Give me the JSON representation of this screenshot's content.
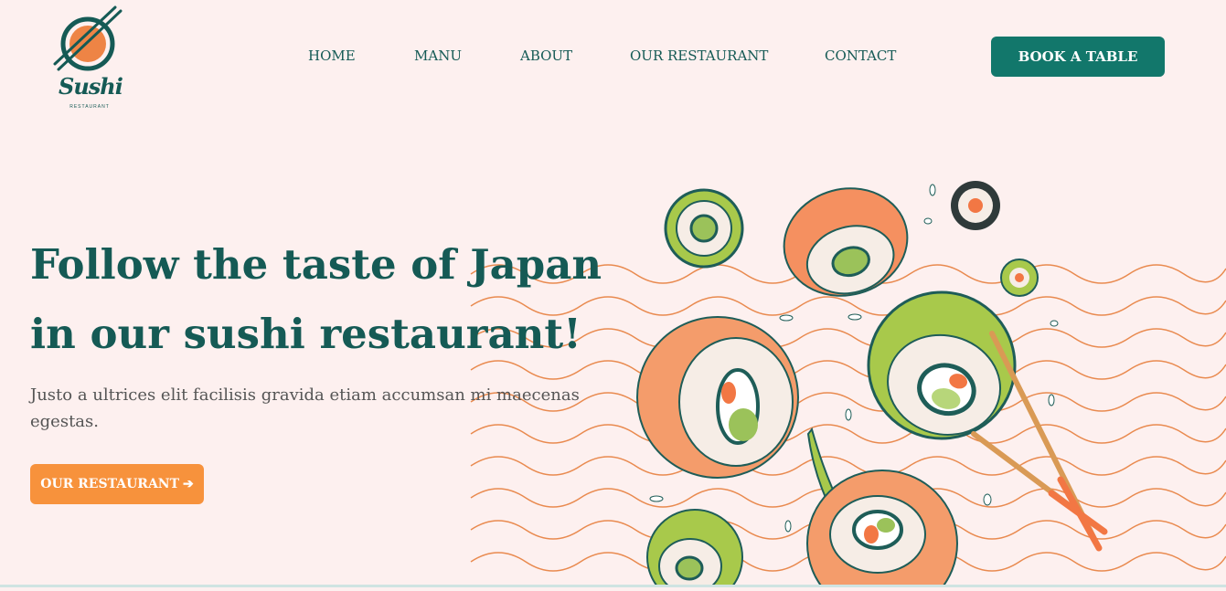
{
  "brand": {
    "name": "Sushi",
    "tagline": "RESTAURANT",
    "colors": {
      "primary": "#155a55",
      "button": "#12776b",
      "accent": "#f7923c",
      "background": "#fdf0ef"
    }
  },
  "nav": {
    "items": [
      {
        "label": "HOME"
      },
      {
        "label": "MANU"
      },
      {
        "label": "ABOUT"
      },
      {
        "label": "OUR RESTAURANT"
      },
      {
        "label": "CONTACT"
      }
    ]
  },
  "header": {
    "cta_label": "BOOK A TABLE"
  },
  "hero": {
    "title_line1": "Follow the taste of Japan",
    "title_line2": "in our sushi restaurant!",
    "text": "Justo a ultrices elit facilisis gravida etiam accumsan mi maecenas egestas.",
    "cta_label": "OUR RESTAURANT",
    "cta_icon": "arrow-right-icon",
    "image": "sushi-rolls-illustration"
  }
}
